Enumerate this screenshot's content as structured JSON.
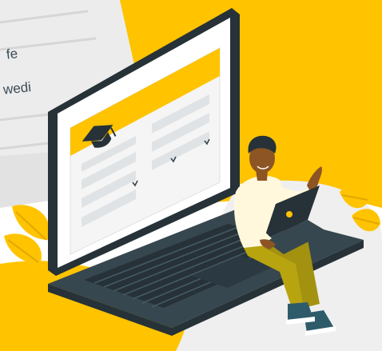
{
  "background_document": {
    "visible_text": [
      "fe",
      "wedi"
    ]
  },
  "laptop_form": {
    "icon": "graduation-cap-icon",
    "dropdown_icon": "chevron-down-icon"
  },
  "colors": {
    "accent_yellow": "#FFC300",
    "laptop_dark": "#263238",
    "screen_panel": "#F5F5F5",
    "field_grey": "#E0E3E5",
    "shirt": "#FFF8DC",
    "pants": "#B7A40F",
    "sneakers": "#2E5B6A",
    "plant": "#FFC300"
  }
}
